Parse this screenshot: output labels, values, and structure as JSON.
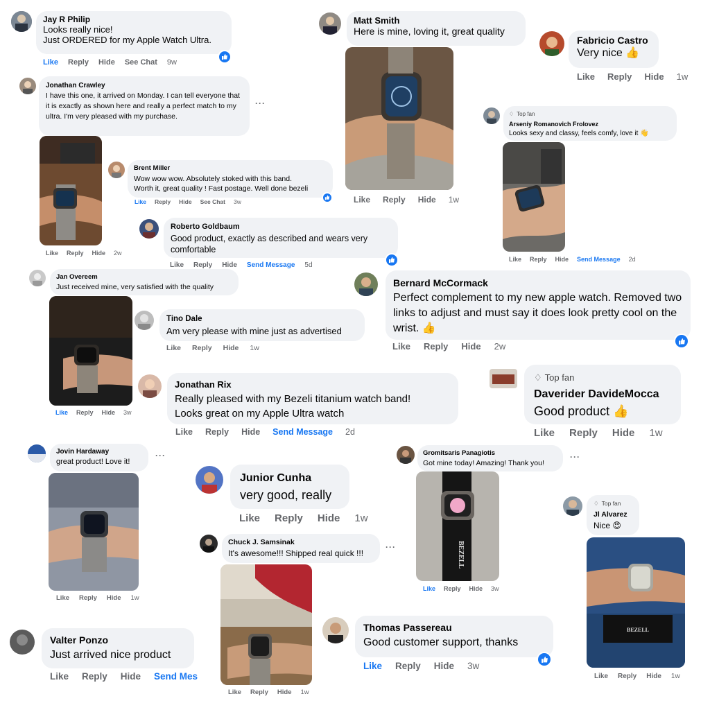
{
  "comments": {
    "jay": {
      "name": "Jay R Philip",
      "text1": "Looks really nice!",
      "text2": "Just ORDERED for my Apple Watch Ultra.",
      "like": "Like",
      "reply": "Reply",
      "hide": "Hide",
      "see_chat": "See Chat",
      "time": "9w"
    },
    "matt": {
      "name": "Matt Smith",
      "text": "Here is mine, loving it, great quality",
      "like": "Like",
      "reply": "Reply",
      "hide": "Hide",
      "time": "1w"
    },
    "fabricio": {
      "name": "Fabricio Castro",
      "text": "Very nice",
      "like": "Like",
      "reply": "Reply",
      "hide": "Hide",
      "time": "1w"
    },
    "jonathan_c": {
      "name": "Jonathan Crawley",
      "text": "I have this one, it arrived on Monday. I can tell everyone that it is exactly as shown here and really a perfect match to my ultra. I'm very pleased with my purchase.",
      "like": "Like",
      "reply": "Reply",
      "hide": "Hide",
      "time": "2w"
    },
    "arseniy": {
      "badge": "Top fan",
      "name": "Arseniy Romanovich Frolovez",
      "text": "Looks sexy and classy, feels comfy, love it",
      "like": "Like",
      "reply": "Reply",
      "hide": "Hide",
      "send": "Send Message",
      "time": "2d"
    },
    "brent": {
      "name": "Brent Miller",
      "text1": "Wow wow wow. Absolutely stoked with this band.",
      "text2": "Worth it, great quality ! Fast postage. Well done bezeli",
      "like": "Like",
      "reply": "Reply",
      "hide": "Hide",
      "see_chat": "See Chat",
      "time": "3w"
    },
    "roberto": {
      "name": "Roberto Goldbaum",
      "text": "Good product, exactly as described and wears very comfortable",
      "like": "Like",
      "reply": "Reply",
      "hide": "Hide",
      "send": "Send Message",
      "time": "5d"
    },
    "jan": {
      "name": "Jan Overeem",
      "text": "Just received mine, very satisfied with the quality",
      "like": "Like",
      "reply": "Reply",
      "hide": "Hide",
      "time": "3w"
    },
    "bernard": {
      "name": "Bernard McCormack",
      "text": "Perfect complement to my new apple watch. Removed two links to adjust and must say it does look pretty cool on the wrist.",
      "like": "Like",
      "reply": "Reply",
      "hide": "Hide",
      "time": "2w"
    },
    "tino": {
      "name": "Tino Dale",
      "text": "Am very please with mine just as advertised",
      "like": "Like",
      "reply": "Reply",
      "hide": "Hide",
      "time": "1w"
    },
    "jonathan_r": {
      "name": "Jonathan Rix",
      "text1": "Really pleased with my Bezeli titanium watch band!",
      "text2": "Looks great on my Apple Ultra watch",
      "like": "Like",
      "reply": "Reply",
      "hide": "Hide",
      "send": "Send Message",
      "time": "2d"
    },
    "daverider": {
      "badge": "Top fan",
      "name": "Daverider DavideMocca",
      "text": "Good product",
      "like": "Like",
      "reply": "Reply",
      "hide": "Hide",
      "time": "1w"
    },
    "jovin": {
      "name": "Jovin Hardaway",
      "text": "great product! Love it!",
      "like": "Like",
      "reply": "Reply",
      "hide": "Hide",
      "time": "1w"
    },
    "junior": {
      "name": "Junior Cunha",
      "text": "very good, really",
      "like": "Like",
      "reply": "Reply",
      "hide": "Hide",
      "time": "1w"
    },
    "gromitsaris": {
      "name": "Gromitsaris Panagiotis",
      "text": "Got mine today! Amazing! Thank you!",
      "like": "Like",
      "reply": "Reply",
      "hide": "Hide",
      "time": "3w"
    },
    "jl": {
      "badge": "Top fan",
      "name": "Jl Alvarez",
      "text": "Nice",
      "like": "Like",
      "reply": "Reply",
      "hide": "Hide",
      "time": "1w"
    },
    "chuck": {
      "name": "Chuck J. Samsinak",
      "text": "It's awesome!!! Shipped real quick !!!",
      "like": "Like",
      "reply": "Reply",
      "hide": "Hide",
      "time": "1w"
    },
    "valter": {
      "name": "Valter Ponzo",
      "text": "Just arrived nice product",
      "like": "Like",
      "reply": "Reply",
      "hide": "Hide",
      "send": "Send Mes"
    },
    "thomas": {
      "name": "Thomas Passereau",
      "text": "Good customer support, thanks",
      "like": "Like",
      "reply": "Reply",
      "hide": "Hide",
      "time": "3w"
    }
  },
  "brand": {
    "box_text": "BEZELL",
    "card_text": "BEZELL"
  },
  "icons": {
    "like": "like-thumb-icon",
    "dots": "more-options-icon",
    "top_fan": "diamond-icon",
    "emoji_thumb": "thumbs-up-emoji",
    "emoji_heart_eyes": "heart-eyes-emoji",
    "emoji_hand": "waving-hand-emoji"
  },
  "colors": {
    "bubble": "#f0f2f5",
    "link_blue": "#1877f2",
    "meta_gray": "#65676b"
  }
}
